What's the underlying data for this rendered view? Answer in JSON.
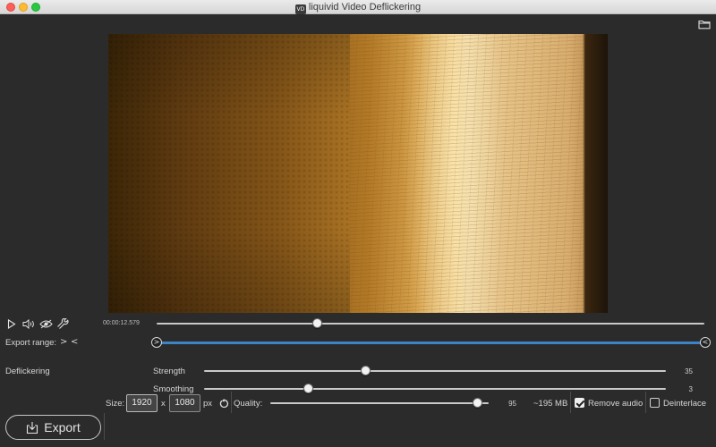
{
  "window": {
    "title": "liquivid Video Deflickering",
    "app_icon_text": "VD"
  },
  "icons": {
    "folder": "folder-open-icon",
    "play": "play-icon",
    "volume": "speaker-icon",
    "preview": "eye-slash-icon",
    "settings": "wrench-icon",
    "export": "export-download-icon",
    "reset": "reset-size-icon"
  },
  "player": {
    "timecode": "00:00:12.579",
    "position_fraction": 0.294
  },
  "export_range": {
    "label": "Export range:",
    "start_marker": ">",
    "end_marker": "<",
    "start_fraction": 0.0,
    "end_fraction": 1.0,
    "accent_color": "#3d84c6"
  },
  "deflickering": {
    "section_label": "Deflickering",
    "strength": {
      "label": "Strength",
      "value": "35",
      "fraction": 0.35
    },
    "smoothing": {
      "label": "Smoothing",
      "value": "3",
      "fraction": 0.225
    }
  },
  "bottom_bar": {
    "export_label": "Export",
    "size_label": "Size:",
    "width": "1920",
    "times": "x",
    "height": "1080",
    "unit": "px",
    "quality_label": "Quality:",
    "quality_value": "95",
    "quality_fraction": 0.95,
    "estimated_size": "~195 MB",
    "remove_audio_label": "Remove audio",
    "remove_audio_checked": true,
    "deinterlace_label": "Deinterlace",
    "deinterlace_checked": false
  }
}
